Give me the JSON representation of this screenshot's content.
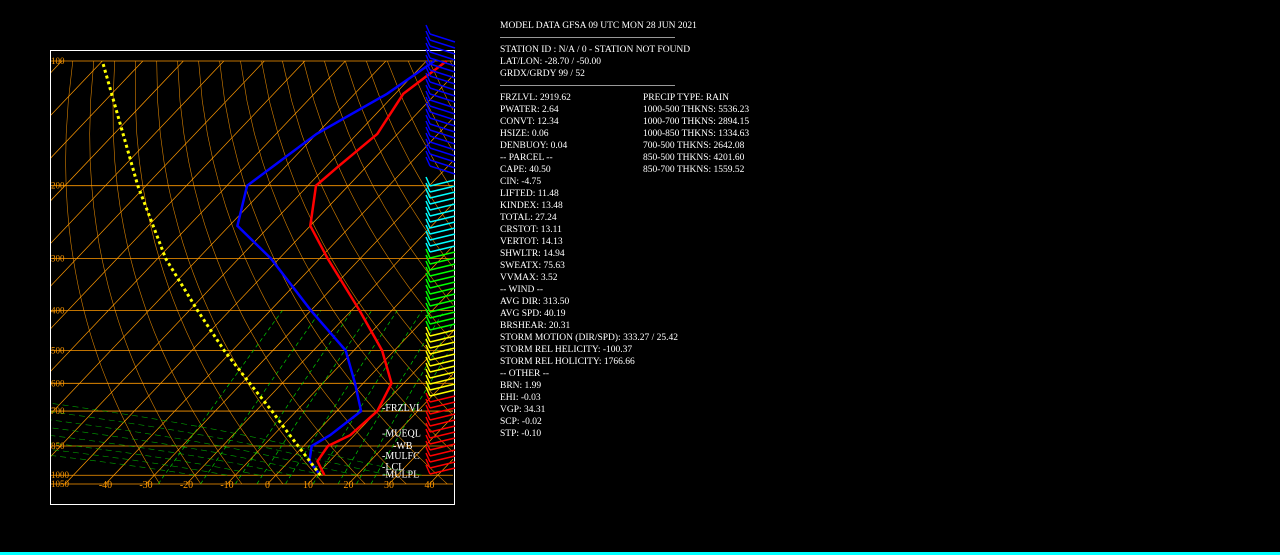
{
  "chart_data": {
    "type": "line",
    "title": "",
    "xlabel": "",
    "ylabel": "",
    "xlim": [
      -50,
      40
    ],
    "x_ticks": [
      "-40",
      "-30",
      "-20",
      "-10",
      "0",
      "10",
      "20",
      "30",
      "40"
    ],
    "pressure_ticks": [
      "100",
      "200",
      "300",
      "400",
      "500",
      "600",
      "700",
      "850",
      "1000",
      "1050"
    ],
    "series": [
      {
        "key": "temperature",
        "color": "#ff0000",
        "points": [
          [
            1000,
            12
          ],
          [
            925,
            7
          ],
          [
            850,
            6
          ],
          [
            800,
            9
          ],
          [
            700,
            10
          ],
          [
            600,
            7
          ],
          [
            500,
            -3
          ],
          [
            400,
            -18
          ],
          [
            300,
            -38
          ],
          [
            250,
            -50
          ],
          [
            200,
            -58
          ],
          [
            180,
            -57
          ],
          [
            150,
            -55
          ],
          [
            120,
            -58
          ],
          [
            100,
            -55
          ]
        ]
      },
      {
        "key": "dewpoint",
        "color": "#0000ff",
        "points": [
          [
            1000,
            11
          ],
          [
            925,
            5
          ],
          [
            850,
            2
          ],
          [
            800,
            4
          ],
          [
            700,
            6
          ],
          [
            600,
            -2
          ],
          [
            500,
            -12
          ],
          [
            400,
            -30
          ],
          [
            300,
            -52
          ],
          [
            250,
            -68
          ],
          [
            200,
            -75
          ],
          [
            150,
            -70
          ],
          [
            120,
            -62
          ],
          [
            100,
            -58
          ]
        ]
      },
      {
        "key": "parcel",
        "color": "#ffff00",
        "points": [
          [
            1000,
            11
          ],
          [
            900,
            3
          ],
          [
            800,
            -6
          ],
          [
            700,
            -16
          ],
          [
            600,
            -28
          ],
          [
            500,
            -42
          ],
          [
            400,
            -58
          ],
          [
            300,
            -78
          ],
          [
            200,
            -102
          ],
          [
            100,
            -140
          ]
        ]
      }
    ],
    "level_labels": [
      {
        "text": "FRZLVL",
        "p": 700
      },
      {
        "text": "MUEQL",
        "p": 820
      },
      {
        "text": "WB",
        "p": 840
      },
      {
        "text": "MULFC",
        "p": 935
      },
      {
        "text": "LCL",
        "p": 955
      },
      {
        "text": "MULPL",
        "p": 970
      }
    ]
  },
  "header": {
    "title": "MODEL DATA GFSA 09 UTC MON 28 JUN 2021",
    "station": "STATION ID :  N/A  /    0   - STATION NOT FOUND",
    "latlon": "LAT/LON:     -28.70 /    -50.00",
    "grid": "GRDX/GRDY   99 /   52"
  },
  "params_left": [
    "FRZLVL:       2919.62",
    "PWATER:        2.64",
    "CONVT:          12.34",
    "HSIZE:          0.06",
    "DENBUOY:         0.04",
    "-- PARCEL --",
    "CAPE:          40.50",
    "CIN:         -4.75",
    "LIFTED:        11.48",
    "KINDEX:        13.48",
    "TOTAL:         27.24",
    "CRSTOT:         13.11",
    "VERTOT:         14.13",
    "SHWLTR:         14.94",
    "SWEATX:         75.63",
    "VVMAX:          3.52",
    "-- WIND --",
    "AVG DIR:        313.50",
    "AVG SPD:        40.19",
    "BRSHEAR:        20.31",
    "STORM MOTION (DIR/SPD):        333.27 /     25.42",
    "STORM REL HELICITY:        -100.37",
    "STORM REL HOLICITY:       1766.66",
    "-- OTHER --",
    "BRN:            1.99",
    "EHI:            -0.03",
    "VGP:            34.31",
    "SCP:            -0.02",
    "STP:            -0.10"
  ],
  "params_right": [
    "PRECIP TYPE: RAIN",
    "1000-500 THKNS:    5536.23",
    "1000-700 THKNS:    2894.15",
    "1000-850 THKNS:    1334.63",
    "700-500  THKNS:    2642.08",
    "850-500  THKNS:    4201.60",
    "850-700  THKNS:    1559.52"
  ],
  "colors": {
    "frame": "#ffffff",
    "isotherm": "#ff9900",
    "isobar": "#ff9900",
    "mixing_ratio": "#00cc00",
    "text": "#ffffff"
  }
}
